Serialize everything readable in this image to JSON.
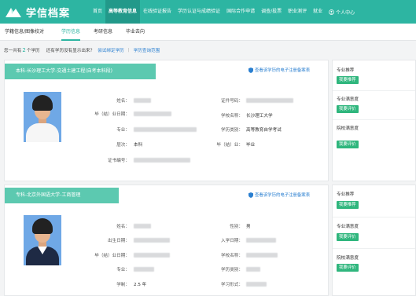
{
  "app": {
    "title": "学信档案"
  },
  "nav": {
    "items": [
      "首页",
      "高等教育信息",
      "在线验证报告",
      "学历认证与成绩验证",
      "国际合作申请",
      "调查/投票",
      "职业测评",
      "就业"
    ],
    "active_index": 1,
    "user": "个人中心"
  },
  "subnav": {
    "items": [
      "学籍信息/图像校对",
      "学历信息",
      "考研信息",
      "毕业去向"
    ],
    "active_index": 1
  },
  "infobar": {
    "prefix": "您一共有",
    "count": "2",
    "suffix": "个学历",
    "question": "还有学历没有显示出来？",
    "bind_link": "尝试绑定学历",
    "query_link": "学历查询范围"
  },
  "records": [
    {
      "header": "本科-长沙理工大学-交通土建工程(自考本科段)",
      "ecert": "查看该学历的电子注册备案表",
      "left_fields": [
        {
          "label": "姓名：",
          "value": ""
        },
        {
          "label": "毕（结）业日期：",
          "value": ""
        },
        {
          "label": "专业：",
          "value": ""
        },
        {
          "label": "层次：",
          "value": "本科"
        },
        {
          "label": "证书编号：",
          "value": ""
        }
      ],
      "right_fields": [
        {
          "label": "证件号码：",
          "value": ""
        },
        {
          "label": "学校名称：",
          "value": "长沙理工大学"
        },
        {
          "label": "学历类别：",
          "value": "高等教育自学考试"
        },
        {
          "label": "毕（结）业：",
          "value": "毕业"
        }
      ]
    },
    {
      "header": "专科-北京外国语大学-工商管理",
      "ecert": "查看该学历的电子注册备案表",
      "left_fields": [
        {
          "label": "姓名：",
          "value": ""
        },
        {
          "label": "出生日期：",
          "value": ""
        },
        {
          "label": "毕（结）业日期：",
          "value": ""
        },
        {
          "label": "专业：",
          "value": ""
        },
        {
          "label": "学制：",
          "value": "2.5 年"
        }
      ],
      "right_fields": [
        {
          "label": "性别：",
          "value": "男"
        },
        {
          "label": "入学日期：",
          "value": ""
        },
        {
          "label": "学校名称：",
          "value": ""
        },
        {
          "label": "学历类别：",
          "value": ""
        },
        {
          "label": "学习形式：",
          "value": ""
        }
      ]
    }
  ],
  "sidebar": [
    {
      "sections": [
        {
          "title": "专业推荐",
          "button": "我要推荐"
        },
        {
          "title": "专业满意度",
          "button": "我要评价"
        },
        {
          "title": "院校满意度",
          "button": "我要评价"
        }
      ]
    },
    {
      "sections": [
        {
          "title": "专业推荐",
          "button": "我要推荐"
        },
        {
          "title": "专业满意度",
          "button": "我要评价"
        },
        {
          "title": "院校满意度",
          "button": "我要评价"
        }
      ]
    }
  ],
  "colors": {
    "brand": "#2db5a2",
    "header": "#5cc9b0",
    "button": "#2fb67d",
    "link": "#2a7fd0"
  }
}
